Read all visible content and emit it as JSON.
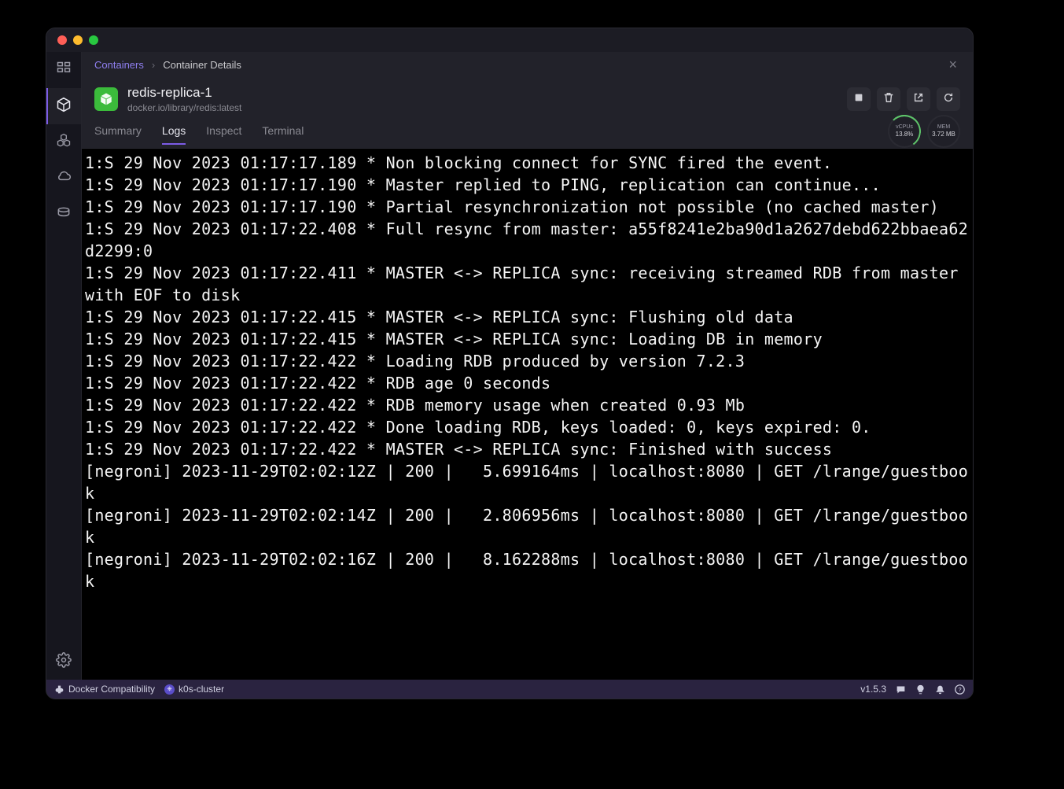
{
  "breadcrumb": {
    "root": "Containers",
    "current": "Container Details"
  },
  "container": {
    "name": "redis-replica-1",
    "image": "docker.io/library/redis:latest"
  },
  "toolbar": {},
  "stats": {
    "cpu_label": "vCPUs",
    "cpu_value": "13.8%",
    "mem_label": "MEM",
    "mem_value": "3.72 MB"
  },
  "tabs": [
    "Summary",
    "Logs",
    "Inspect",
    "Terminal"
  ],
  "active_tab_index": 1,
  "statusbar": {
    "docker": "Docker Compatibility",
    "cluster": "k0s-cluster",
    "version": "v1.5.3"
  },
  "log_lines": [
    "1:S 29 Nov 2023 01:17:17.189 * Non blocking connect for SYNC fired the event.",
    "1:S 29 Nov 2023 01:17:17.190 * Master replied to PING, replication can continue...",
    "1:S 29 Nov 2023 01:17:17.190 * Partial resynchronization not possible (no cached master)",
    "1:S 29 Nov 2023 01:17:22.408 * Full resync from master: a55f8241e2ba90d1a2627debd622bbaea62d2299:0",
    "1:S 29 Nov 2023 01:17:22.411 * MASTER <-> REPLICA sync: receiving streamed RDB from master with EOF to disk",
    "1:S 29 Nov 2023 01:17:22.415 * MASTER <-> REPLICA sync: Flushing old data",
    "1:S 29 Nov 2023 01:17:22.415 * MASTER <-> REPLICA sync: Loading DB in memory",
    "1:S 29 Nov 2023 01:17:22.422 * Loading RDB produced by version 7.2.3",
    "1:S 29 Nov 2023 01:17:22.422 * RDB age 0 seconds",
    "1:S 29 Nov 2023 01:17:22.422 * RDB memory usage when created 0.93 Mb",
    "1:S 29 Nov 2023 01:17:22.422 * Done loading RDB, keys loaded: 0, keys expired: 0.",
    "1:S 29 Nov 2023 01:17:22.422 * MASTER <-> REPLICA sync: Finished with success",
    "[negroni] 2023-11-29T02:02:12Z | 200 |   5.699164ms | localhost:8080 | GET /lrange/guestbook",
    "[negroni] 2023-11-29T02:02:14Z | 200 |   2.806956ms | localhost:8080 | GET /lrange/guestbook",
    "[negroni] 2023-11-29T02:02:16Z | 200 |   8.162288ms | localhost:8080 | GET /lrange/guestbook"
  ]
}
